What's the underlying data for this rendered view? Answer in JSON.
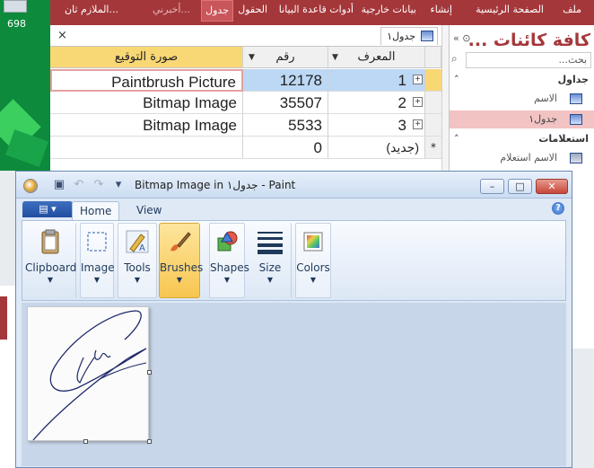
{
  "desktop": {
    "count": "698"
  },
  "ribbon_tabs": [
    "ملف",
    "الصفحة الرئيسية",
    "إنشاء",
    "بيانات خارجية",
    "أدوات قاعدة البيانا",
    "الحقول",
    "جدول",
    "أخبرني...",
    "الملازم ثان..."
  ],
  "nav": {
    "title": "كافة كائنات ...",
    "search_placeholder": "بحث...",
    "groups": [
      {
        "label": "جداول",
        "items": [
          {
            "label": "الاسم",
            "selected": false
          },
          {
            "label": "جدول١",
            "selected": true
          }
        ]
      },
      {
        "label": "استعلامات",
        "items": [
          {
            "label": "الاسم استعلام",
            "selected": false
          }
        ]
      }
    ]
  },
  "datasheet": {
    "tab_label": "جدول١",
    "close_label": "×",
    "columns": [
      "المعرف",
      "رقم",
      "صورة التوقيع"
    ],
    "rows": [
      {
        "id": "1",
        "number": "12178",
        "picture": "Paintbrush Picture"
      },
      {
        "id": "2",
        "number": "35507",
        "picture": "Bitmap Image"
      },
      {
        "id": "3",
        "number": "5533",
        "picture": "Bitmap Image"
      },
      {
        "id": "(جديد)",
        "number": "0",
        "picture": ""
      }
    ],
    "new_row_marker": "*"
  },
  "paint": {
    "title": "Bitmap Image in جدول١ - Paint",
    "tabs": [
      "Home",
      "View"
    ],
    "groups": [
      "Clipboard",
      "Image",
      "Tools",
      "Brushes",
      "Shapes",
      "Size",
      "Colors"
    ],
    "help_label": "?",
    "window_buttons": {
      "minimize": "–",
      "maximize": "□",
      "close": "✕"
    }
  }
}
